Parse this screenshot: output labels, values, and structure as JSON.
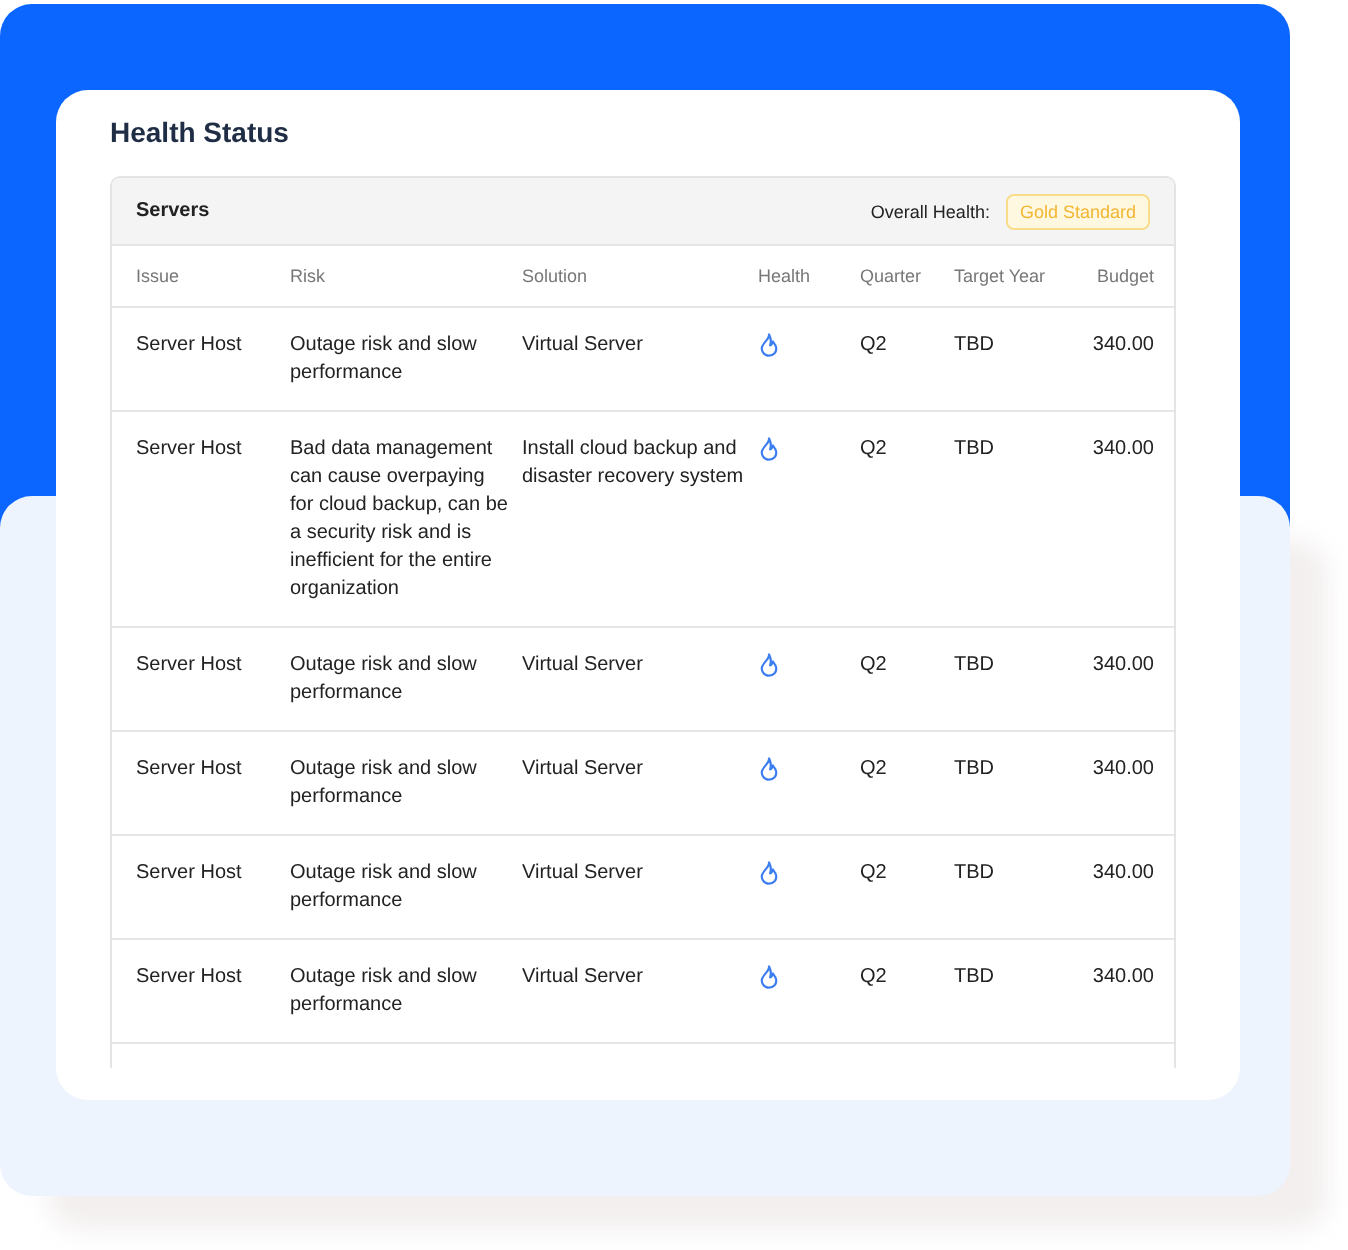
{
  "title": "Health Status",
  "table": {
    "name": "Servers",
    "overall_health_label": "Overall Health:",
    "overall_health_badge": "Gold Standard",
    "columns": [
      "Issue",
      "Risk",
      "Solution",
      "Health",
      "Quarter",
      "Target Year",
      "Budget"
    ],
    "rows": [
      {
        "issue": "Server Host",
        "risk": "Outage risk and slow performance",
        "solution": "Virtual Server",
        "quarter": "Q2",
        "target_year": "TBD",
        "budget": "340.00"
      },
      {
        "issue": "Server Host",
        "risk": "Bad data management can cause overpaying for cloud backup, can be a security risk and is inefficient for the entire organization",
        "solution": "Install cloud backup and disaster recovery system",
        "quarter": "Q2",
        "target_year": "TBD",
        "budget": "340.00"
      },
      {
        "issue": "Server Host",
        "risk": "Outage risk and slow performance",
        "solution": "Virtual Server",
        "quarter": "Q2",
        "target_year": "TBD",
        "budget": "340.00"
      },
      {
        "issue": "Server Host",
        "risk": "Outage risk and slow performance",
        "solution": "Virtual Server",
        "quarter": "Q2",
        "target_year": "TBD",
        "budget": "340.00"
      },
      {
        "issue": "Server Host",
        "risk": "Outage risk and slow performance",
        "solution": "Virtual Server",
        "quarter": "Q2",
        "target_year": "TBD",
        "budget": "340.00"
      },
      {
        "issue": "Server Host",
        "risk": "Outage risk and slow performance",
        "solution": "Virtual Server",
        "quarter": "Q2",
        "target_year": "TBD",
        "budget": "340.00"
      }
    ]
  }
}
